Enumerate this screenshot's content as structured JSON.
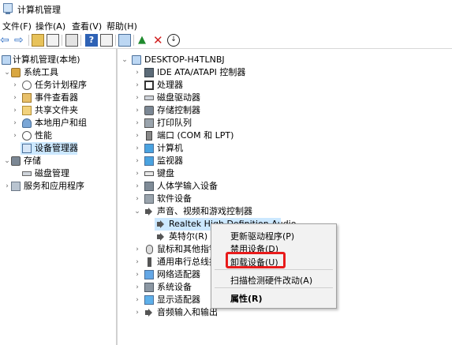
{
  "window": {
    "title": "计算机管理"
  },
  "menu": [
    "文件(F)",
    "操作(A)",
    "查看(V)",
    "帮助(H)"
  ],
  "left_tree": [
    {
      "label": "计算机管理(本地)",
      "expander": "",
      "icon": "computer-icon"
    },
    {
      "label": "系统工具",
      "expander": "⌄",
      "icon": "system-tools-icon"
    },
    {
      "label": "任务计划程序",
      "expander": "›",
      "icon": "task-scheduler-icon"
    },
    {
      "label": "事件查看器",
      "expander": "›",
      "icon": "event-viewer-icon"
    },
    {
      "label": "共享文件夹",
      "expander": "›",
      "icon": "shared-folders-icon"
    },
    {
      "label": "本地用户和组",
      "expander": "›",
      "icon": "local-users-icon"
    },
    {
      "label": "性能",
      "expander": "›",
      "icon": "performance-icon"
    },
    {
      "label": "设备管理器",
      "expander": "",
      "icon": "device-manager-icon",
      "selected": true
    },
    {
      "label": "存储",
      "expander": "⌄",
      "icon": "storage-icon"
    },
    {
      "label": "磁盘管理",
      "expander": "",
      "icon": "disk-management-icon"
    },
    {
      "label": "服务和应用程序",
      "expander": "›",
      "icon": "services-apps-icon"
    }
  ],
  "right_tree": [
    {
      "label": "DESKTOP-H4TLNBJ",
      "expander": "⌄",
      "icon": "computer-icon"
    },
    {
      "label": "IDE ATA/ATAPI 控制器",
      "expander": "›",
      "icon": "ide-controller-icon"
    },
    {
      "label": "处理器",
      "expander": "›",
      "icon": "processor-icon"
    },
    {
      "label": "磁盘驱动器",
      "expander": "›",
      "icon": "disk-drive-icon"
    },
    {
      "label": "存储控制器",
      "expander": "›",
      "icon": "storage-controller-icon"
    },
    {
      "label": "打印队列",
      "expander": "›",
      "icon": "print-queue-icon"
    },
    {
      "label": "端口 (COM 和 LPT)",
      "expander": "›",
      "icon": "port-icon"
    },
    {
      "label": "计算机",
      "expander": "›",
      "icon": "computer-icon"
    },
    {
      "label": "监视器",
      "expander": "›",
      "icon": "monitor-icon"
    },
    {
      "label": "键盘",
      "expander": "›",
      "icon": "keyboard-icon"
    },
    {
      "label": "人体学输入设备",
      "expander": "›",
      "icon": "hid-icon"
    },
    {
      "label": "软件设备",
      "expander": "›",
      "icon": "software-device-icon"
    },
    {
      "label": "声音、视频和游戏控制器",
      "expander": "⌄",
      "icon": "audio-icon"
    },
    {
      "label": "Realtek High Definition Audio",
      "expander": "",
      "icon": "audio-icon",
      "selected": true
    },
    {
      "label": "英特尔(R) 显",
      "expander": "",
      "icon": "audio-icon"
    },
    {
      "label": "鼠标和其他指针",
      "expander": "›",
      "icon": "mouse-icon"
    },
    {
      "label": "通用串行总线控",
      "expander": "›",
      "icon": "usb-icon"
    },
    {
      "label": "网络适配器",
      "expander": "›",
      "icon": "network-adapter-icon"
    },
    {
      "label": "系统设备",
      "expander": "›",
      "icon": "system-device-icon"
    },
    {
      "label": "显示适配器",
      "expander": "›",
      "icon": "display-adapter-icon"
    },
    {
      "label": "音频输入和输出",
      "expander": "›",
      "icon": "audio-io-icon"
    }
  ],
  "context_menu": {
    "update_driver": "更新驱动程序(P)",
    "disable_device": "禁用设备(D)",
    "uninstall_device": "卸载设备(U)",
    "scan_hardware": "扫描检测硬件改动(A)",
    "properties": "属性(R)"
  },
  "colors": {
    "selection": "#cce8ff",
    "highlight_box": "#e81b1b"
  }
}
